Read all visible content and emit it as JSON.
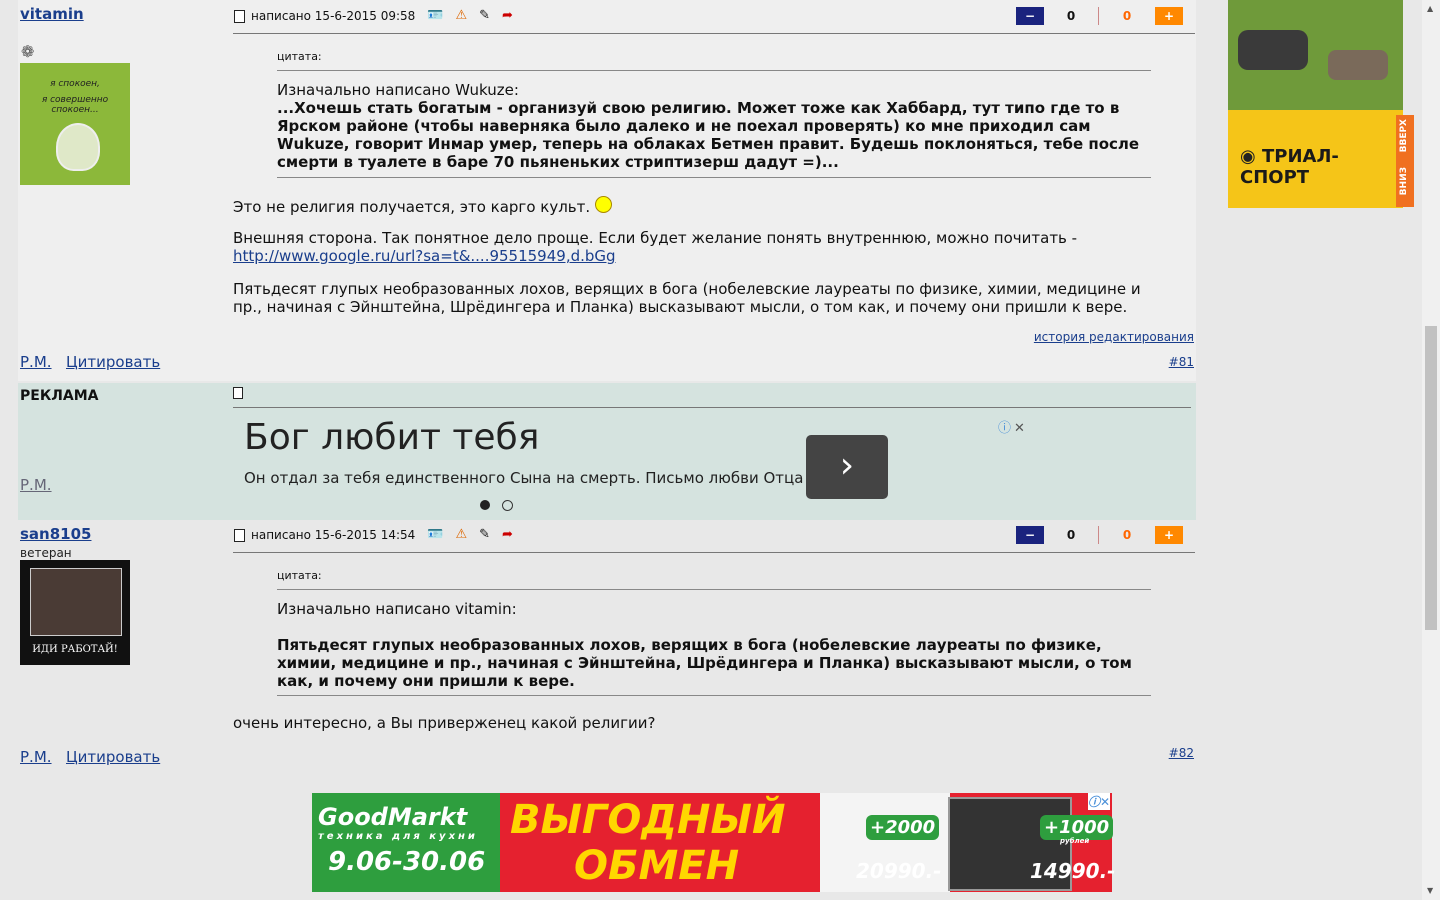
{
  "post1": {
    "author": "vitamin",
    "avatar_text_1": "я спокоен,",
    "avatar_text_2": "я совершенно спокоен...",
    "posted": "написано 15-6-2015 09:58",
    "vote_neg": "0",
    "vote_pos": "0",
    "quote_label": "цитата:",
    "quote_head": "Изначально написано Wukuze:",
    "quote_body": "...Хочешь стать богатым - организуй свою религию. Может тоже как Хаббард, тут типо где то в Ярском районе (чтобы наверняка было далеко и не поехал проверять) ко мне приходил сам Wukuze, говорит Инмар умер, теперь на облаках Бетмен правит. Будешь поклоняться, тебе после смерти в туалете в баре 70 пьяненьких стриптизерш дадут =)...",
    "p1": "Это не религия получается, это карго культ.",
    "p2": "Внешняя сторона. Так понятное дело проще. Если будет желание понять внутреннюю, можно почитать -",
    "p2_link": "http://www.google.ru/url?sa=t&....95515949,d.bGg",
    "p3": "Пятьдесят глупых необразованных лохов, верящих в бога (нобелевские лауреаты по физике, химии, медицине и пр., начиная с Эйнштейна, Шрёдингера и Планка) высказывают мысли, о том как, и почему они пришли к вере.",
    "edit_history": "история редактирования",
    "pm": "Р.М.",
    "quote_btn": "Цитировать",
    "num": "#81"
  },
  "adpost": {
    "label": "РЕКЛАМА",
    "pm": "Р.М.",
    "title": "Бог любит тебя",
    "sub": "Он отдал за тебя единственного Сына на смерть. Письмо любви Отца",
    "btn": "›"
  },
  "post2": {
    "author": "san8105",
    "rank": "ветеран",
    "avatar_caption": "ИДИ РАБОТАЙ!",
    "posted": "написано 15-6-2015 14:54",
    "vote_neg": "0",
    "vote_pos": "0",
    "quote_label": "цитата:",
    "quote_head": "Изначально написано vitamin:",
    "quote_body": "Пятьдесят глупых необразованных лохов, верящих в бога (нобелевские лауреаты по физике, химии, медицине и пр., начиная с Эйнштейна, Шрёдингера и Планка) высказывают мысли, о том как, и почему они пришли к вере.",
    "p1": "очень интересно, а Вы приверженец какой религии?",
    "pm": "Р.М.",
    "quote_btn": "Цитировать",
    "num": "#82"
  },
  "banner": {
    "brand": "GoodMarkt",
    "brand_sub": "техника для кухни",
    "dates": "9.06-30.06",
    "headline1": "ВЫГОДНЫЙ",
    "headline2": "ОБМЕН",
    "bonus1": "+2000",
    "bonus2": "+1000",
    "price1": "20990.-",
    "price2": "14990.-",
    "rub": "рублей"
  },
  "right_ad": {
    "brand": "ТРИАЛ-СПОРТ",
    "up": "ВВЕРХ",
    "down": "ВНИЗ"
  }
}
